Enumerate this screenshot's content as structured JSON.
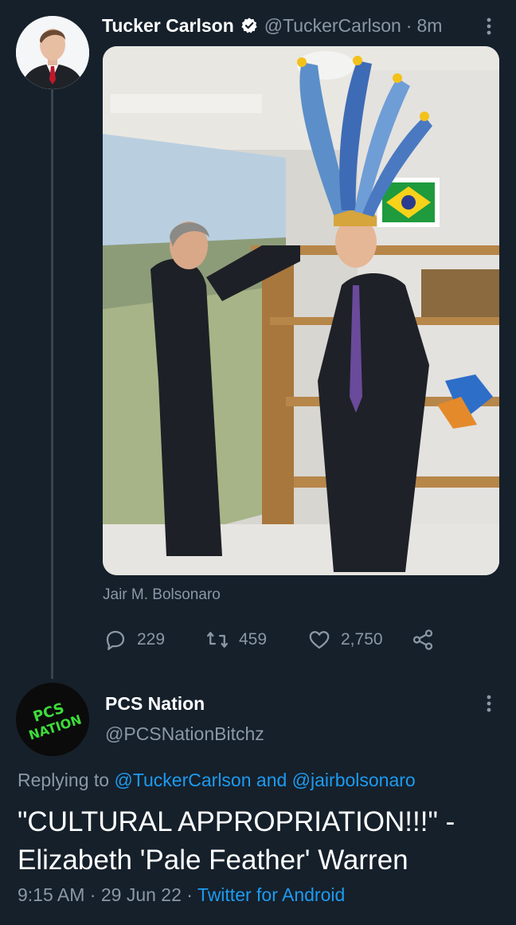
{
  "colors": {
    "background": "#15202b",
    "secondary_text": "#8b98a5",
    "link": "#1d9bf0",
    "verified": "#ffffff"
  },
  "tweet": {
    "author_name": "Tucker Carlson",
    "handle": "@TuckerCarlson",
    "separator": "·",
    "time": "8m",
    "photo_caption": "Jair M. Bolsonaro",
    "replies": "229",
    "retweets": "459",
    "likes": "2,750",
    "icons": [
      "reply-icon",
      "retweet-icon",
      "like-icon",
      "share-icon",
      "verified-icon",
      "more-icon"
    ]
  },
  "reply": {
    "avatar_text": [
      "PCS",
      "NATION"
    ],
    "author_name": "PCS Nation",
    "handle": "@PCSNationBitchz",
    "replying_prefix": "Replying to",
    "replying_user1": "@TuckerCarlson",
    "replying_and": "and",
    "replying_user2": "@jairbolsonaro",
    "text": "\"CULTURAL APPROPRIATION!!!\" - Elizabeth 'Pale Feather' Warren",
    "time": "9:15 AM",
    "date": "29 Jun 22",
    "source": "Twitter for Android",
    "separator": "·"
  }
}
